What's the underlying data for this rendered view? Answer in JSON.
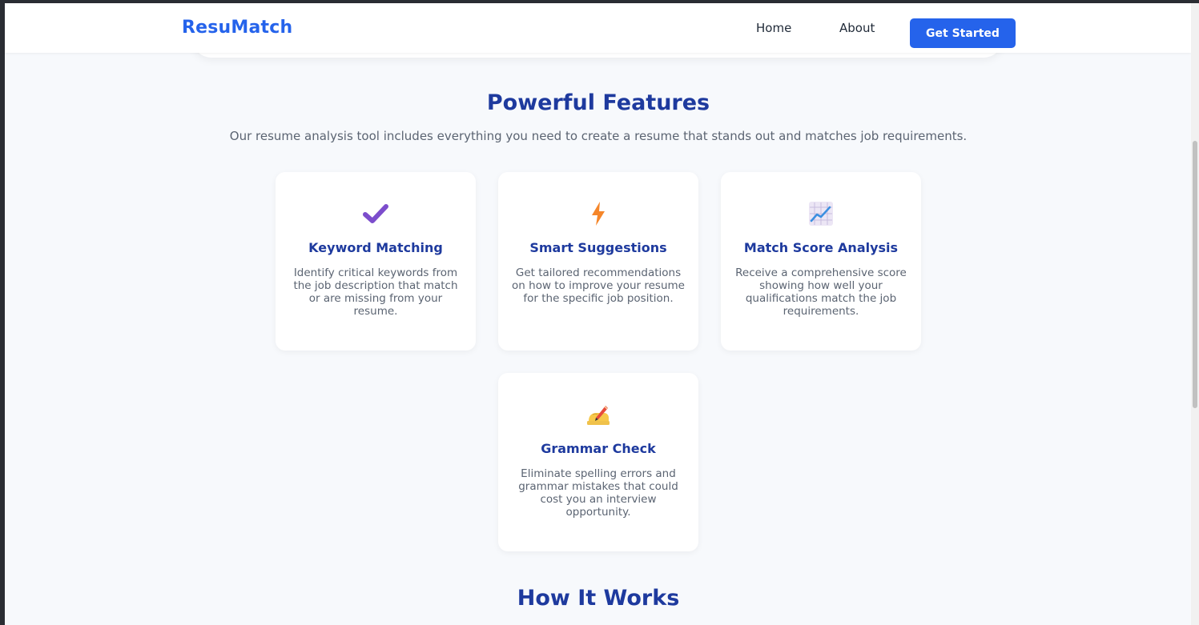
{
  "navbar": {
    "logo": "ResuMatch",
    "links": [
      {
        "label": "Home"
      },
      {
        "label": "About"
      }
    ],
    "cta_label": "Get Started"
  },
  "features": {
    "title": "Powerful Features",
    "subtitle": "Our resume analysis tool includes everything you need to create a resume that stands out and matches job requirements.",
    "cards": [
      {
        "icon": "checkmark-icon",
        "title": "Keyword Matching",
        "description": "Identify critical keywords from the job description that match or are missing from your resume."
      },
      {
        "icon": "lightning-icon",
        "title": "Smart Suggestions",
        "description": "Get tailored recommendations on how to improve your resume for the specific job position."
      },
      {
        "icon": "chart-increasing-icon",
        "title": "Match Score Analysis",
        "description": "Receive a comprehensive score showing how well your qualifications match the job requirements."
      },
      {
        "icon": "writing-hand-icon",
        "title": "Grammar Check",
        "description": "Eliminate spelling errors and grammar mistakes that could cost you an interview opportunity."
      }
    ]
  },
  "how_it_works": {
    "title": "How It Works"
  },
  "colors": {
    "brand": "#2563eb",
    "heading": "#1e3a9e",
    "body_text": "#5b6472",
    "page_bg": "#f7f9fc"
  }
}
